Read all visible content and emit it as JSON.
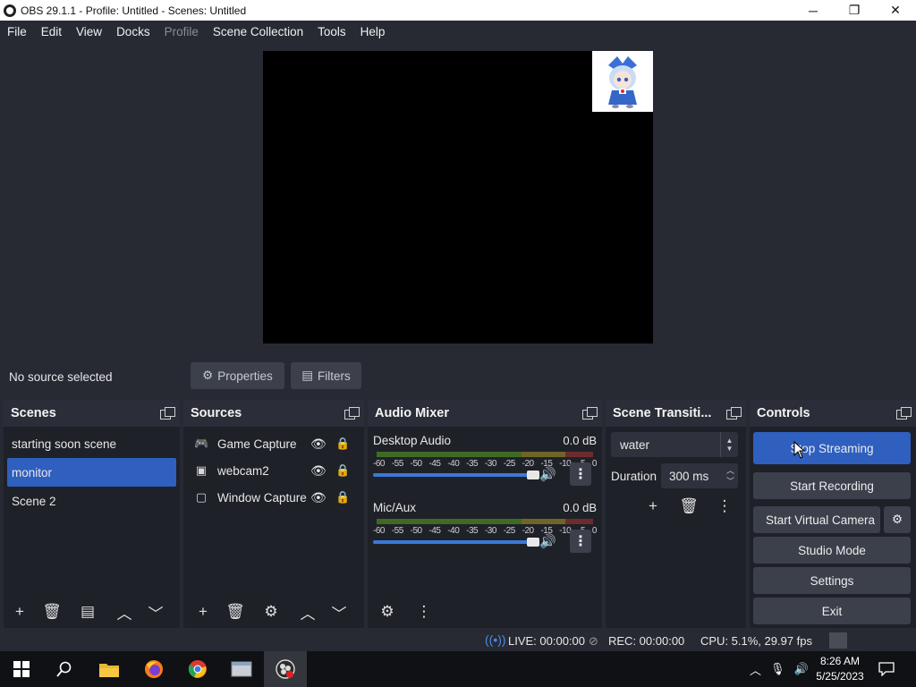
{
  "window": {
    "title": "OBS 29.1.1 - Profile: Untitled - Scenes: Untitled",
    "minimize": "─",
    "restore": "❐",
    "close": "✕"
  },
  "menu": [
    "File",
    "Edit",
    "View",
    "Docks",
    "Profile",
    "Scene Collection",
    "Tools",
    "Help"
  ],
  "source_toolbar": {
    "status": "No source selected",
    "properties": "Properties",
    "filters": "Filters"
  },
  "scenes": {
    "title": "Scenes",
    "items": [
      "starting soon scene",
      "monitor",
      "Scene 2"
    ],
    "selected": "monitor"
  },
  "sources": {
    "title": "Sources",
    "items": [
      {
        "name": "Game Capture",
        "icon": "gamepad-icon"
      },
      {
        "name": "webcam2",
        "icon": "image-icon"
      },
      {
        "name": "Window Capture",
        "icon": "window-icon"
      }
    ]
  },
  "mixer": {
    "title": "Audio Mixer",
    "channels": [
      {
        "name": "Desktop Audio",
        "db": "0.0 dB",
        "level": 1.0
      },
      {
        "name": "Mic/Aux",
        "db": "0.0 dB",
        "level": 1.0
      }
    ],
    "scale": [
      "-60",
      "-55",
      "-50",
      "-45",
      "-40",
      "-35",
      "-30",
      "-25",
      "-20",
      "-15",
      "-10",
      "-5",
      "0"
    ]
  },
  "transitions": {
    "title": "Scene Transiti...",
    "selected": "water",
    "duration_label": "Duration",
    "duration_value": "300 ms"
  },
  "controls": {
    "title": "Controls",
    "stop_streaming": "Stop Streaming",
    "start_recording": "Start Recording",
    "virtual_camera": "Start Virtual Camera",
    "studio_mode": "Studio Mode",
    "settings": "Settings",
    "exit": "Exit"
  },
  "status": {
    "live": "LIVE: 00:00:00",
    "rec": "REC: 00:00:00",
    "cpu": "CPU: 5.1%, 29.97 fps"
  },
  "taskbar": {
    "time": "8:26 AM",
    "date": "5/25/2023"
  },
  "colors": {
    "accent": "#2f5fbf",
    "panel": "#1f2129",
    "background": "#272a33"
  }
}
